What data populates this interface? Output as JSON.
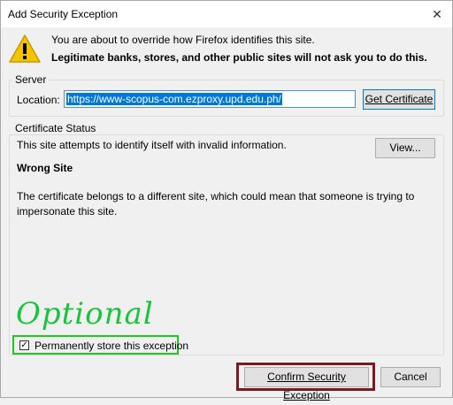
{
  "dialog": {
    "title": "Add Security Exception",
    "close_symbol": "✕"
  },
  "intro": {
    "line1": "You are about to override how Firefox identifies this site.",
    "line2": "Legitimate banks, stores, and other public sites will not ask you to do this."
  },
  "server": {
    "legend": "Server",
    "location_label": "Location:",
    "location_value": "https://www-scopus-com.ezproxy.upd.edu.ph/",
    "get_certificate": "Get Certificate"
  },
  "certificate_status": {
    "legend": "Certificate Status",
    "message": "This site attempts to identify itself with invalid information.",
    "view_button": "View...",
    "problem_title": "Wrong Site",
    "problem_description": "The certificate belongs to a different site, which could mean that someone is trying to impersonate this site."
  },
  "annotation": {
    "optional_text": "Optional",
    "optional_color": "#18c43c",
    "highlight_green": "#1ec81e",
    "highlight_red": "#7a1a1f"
  },
  "permanent": {
    "label": "Permanently store this exception",
    "checked": true,
    "check_glyph": "✓"
  },
  "footer": {
    "confirm": "Confirm Security Exception",
    "cancel": "Cancel"
  },
  "icons": {
    "warning": "warning-icon"
  }
}
